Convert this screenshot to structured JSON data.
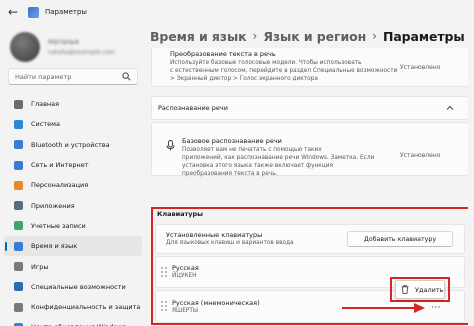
{
  "window": {
    "title": "Параметры"
  },
  "profile": {
    "name": "Наталья",
    "email": "natalia@example.com"
  },
  "search": {
    "placeholder": "Найти параметр"
  },
  "nav": {
    "items": [
      {
        "label": "Главная",
        "icon": "home-icon",
        "color": "#6b6b6b"
      },
      {
        "label": "Система",
        "icon": "system-icon",
        "color": "#2b88d8"
      },
      {
        "label": "Bluetooth и устройства",
        "icon": "bluetooth-icon",
        "color": "#3a7bd5"
      },
      {
        "label": "Сеть и Интернет",
        "icon": "network-icon",
        "color": "#3a7bd5"
      },
      {
        "label": "Персонализация",
        "icon": "brush-icon",
        "color": "#e08a30"
      },
      {
        "label": "Приложения",
        "icon": "apps-icon",
        "color": "#5a6b80"
      },
      {
        "label": "Учетные записи",
        "icon": "account-icon",
        "color": "#3aa86b"
      },
      {
        "label": "Время и язык",
        "icon": "time-language-icon",
        "color": "#3a7bd5"
      },
      {
        "label": "Игры",
        "icon": "games-icon",
        "color": "#7a7a7a"
      },
      {
        "label": "Специальные возможности",
        "icon": "accessibility-icon",
        "color": "#2b6cb0"
      },
      {
        "label": "Конфиденциальность и защита",
        "icon": "shield-icon",
        "color": "#7a7a7a"
      },
      {
        "label": "Центр обновления Windows",
        "icon": "update-icon",
        "color": "#2b88d8"
      }
    ],
    "active_index": 7
  },
  "breadcrumb": {
    "part1": "Время и язык",
    "part2": "Язык и регион",
    "part3": "Параметры"
  },
  "tts": {
    "title": "Преобразование текста в речь",
    "desc1": "Используйте базовые голосовые модели. Чтобы использовать",
    "desc2": "с естественным голосом, перейдите в раздел Специальные возможности",
    "desc3": "> Экранный диктор > Голос экранного диктора",
    "status": "Установлено"
  },
  "speech": {
    "title": "Распознавание речи",
    "item_title": "Базовое распознавание речи",
    "desc1": "Позволяет вам не печатать с помощью таких",
    "desc2": "приложений, как распознавание речи Windows. Заметка. Если",
    "desc3": "установка этого языка также включает функция",
    "desc4": "преобразования текста в речь.",
    "status": "Установлено"
  },
  "keyboards": {
    "section_title": "Клавиатуры",
    "installed_title": "Установленные клавиатуры",
    "installed_desc": "Для языковых клавиш и вариантов ввода",
    "add_button": "Добавить клавиатуру",
    "items": [
      {
        "name": "Русская",
        "layout": "ЙЦУКЕН"
      },
      {
        "name": "Русская (мнемоническая)",
        "layout": "ЯШЕРТЫ"
      }
    ],
    "delete_label": "Удалить",
    "more_label": "···"
  },
  "colors": {
    "accent": "#0067c0",
    "highlight": "#d42626"
  }
}
